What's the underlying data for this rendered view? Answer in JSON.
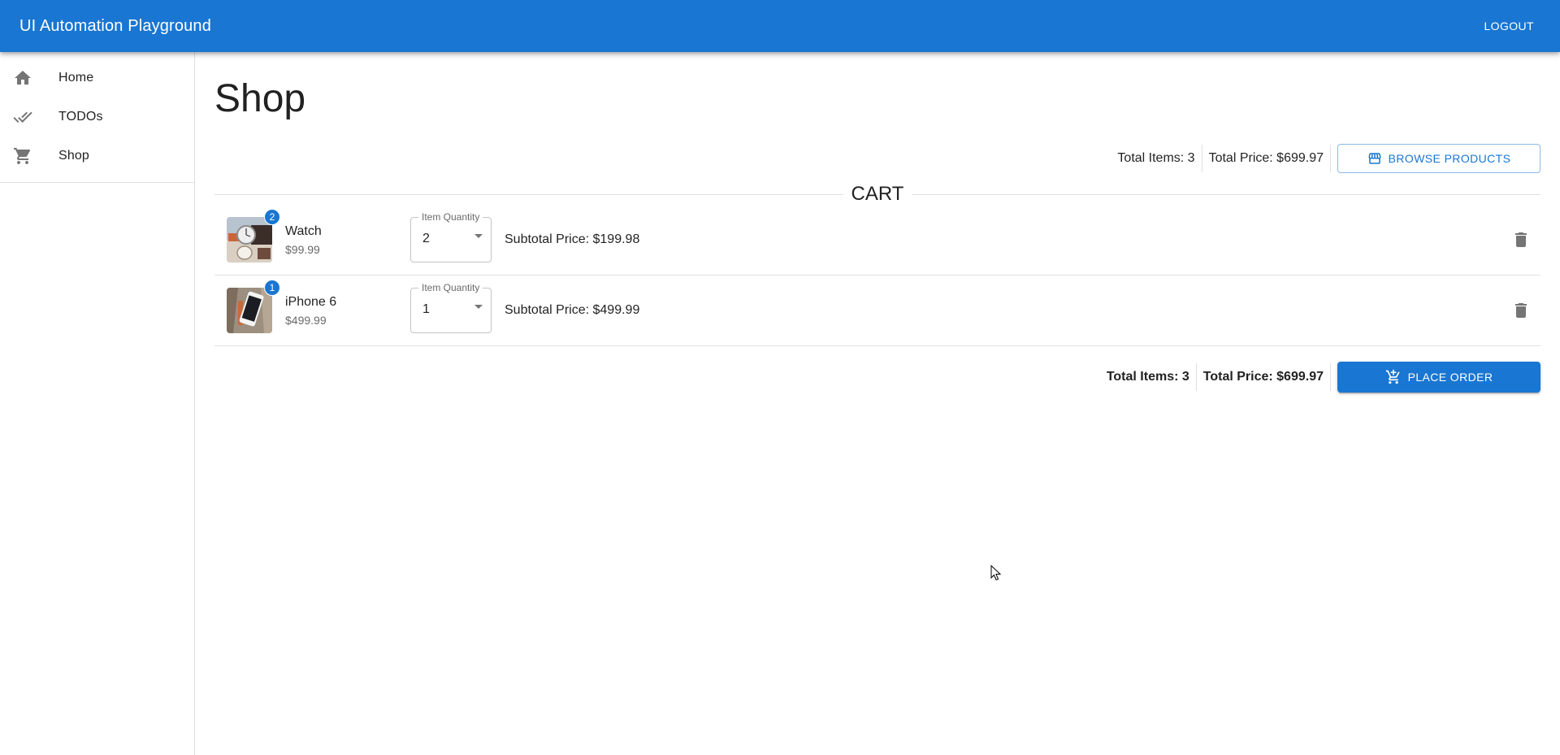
{
  "appbar": {
    "title": "UI Automation Playground",
    "logout_label": "LOGOUT",
    "color": "#1976d2"
  },
  "sidebar": {
    "items": [
      {
        "label": "Home",
        "icon": "home-icon"
      },
      {
        "label": "TODOs",
        "icon": "done-all-icon"
      },
      {
        "label": "Shop",
        "icon": "shopping-cart-icon"
      }
    ]
  },
  "page": {
    "title": "Shop"
  },
  "summary": {
    "total_items": "Total Items: 3",
    "total_price": "Total Price: $699.97",
    "browse_label": "BROWSE PRODUCTS",
    "browse_icon": "storefront-icon"
  },
  "cart": {
    "label": "CART",
    "quantity_label": "Item Quantity",
    "items": [
      {
        "name": "Watch",
        "price": "$99.99",
        "badge": "2",
        "quantity": "2",
        "subtotal": "Subtotal Price: $199.98"
      },
      {
        "name": "iPhone 6",
        "price": "$499.99",
        "badge": "1",
        "quantity": "1",
        "subtotal": "Subtotal Price: $499.99"
      }
    ]
  },
  "footer": {
    "total_items": "Total Items: 3",
    "total_price": "Total Price: $699.97",
    "order_label": "PLACE ORDER",
    "order_icon": "add-shopping-cart-icon"
  }
}
